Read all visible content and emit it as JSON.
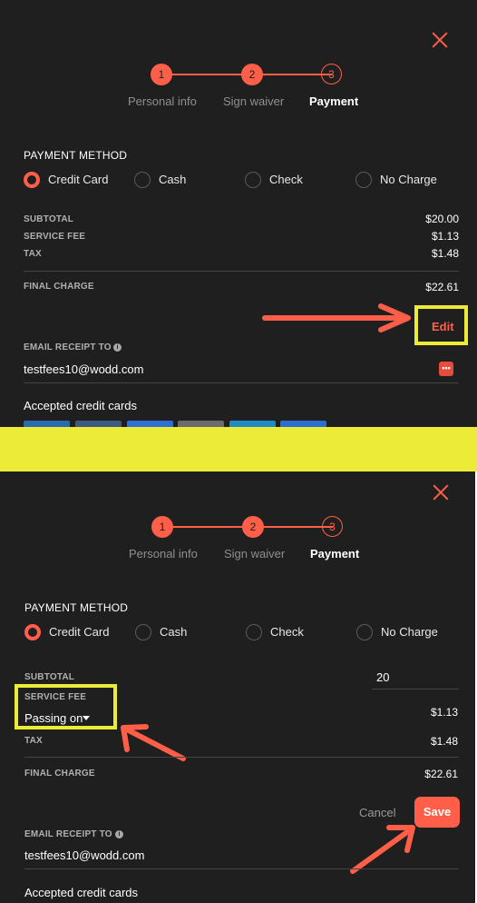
{
  "colors": {
    "accent": "#ff5f49",
    "highlight": "#ebeb38",
    "background": "#1f1f1f"
  },
  "steps": [
    {
      "number": "1",
      "label": "Personal info"
    },
    {
      "number": "2",
      "label": "Sign waiver"
    },
    {
      "number": "3",
      "label": "Payment"
    }
  ],
  "payment_method": {
    "title": "PAYMENT METHOD",
    "options": [
      "Credit Card",
      "Cash",
      "Check",
      "No Charge"
    ],
    "selected": "Credit Card"
  },
  "summary_top": {
    "subtotal_label": "SUBTOTAL",
    "subtotal": "$20.00",
    "service_fee_label": "SERVICE FEE",
    "service_fee": "$1.13",
    "tax_label": "TAX",
    "tax": "$1.48",
    "final_label": "FINAL CHARGE",
    "final": "$22.61",
    "edit_label": "Edit"
  },
  "summary_bottom": {
    "subtotal_label": "SUBTOTAL",
    "subtotal_input": "20",
    "service_fee_label": "SERVICE FEE",
    "service_fee_select": "Passing on",
    "service_fee": "$1.13",
    "tax_label": "TAX",
    "tax": "$1.48",
    "final_label": "FINAL CHARGE",
    "final": "$22.61",
    "cancel_label": "Cancel",
    "save_label": "Save"
  },
  "receipt": {
    "label": "EMAIL RECEIPT TO",
    "info_icon": "i",
    "email": "testfees10@wodd.com",
    "more_icon": "•••"
  },
  "accepted_cards_title": "Accepted credit cards",
  "card_colors": [
    "#2b6cb0",
    "#3d5a80",
    "#2f6fd6",
    "#6b6b6b",
    "#1e8bc3",
    "#2a6fd1"
  ]
}
